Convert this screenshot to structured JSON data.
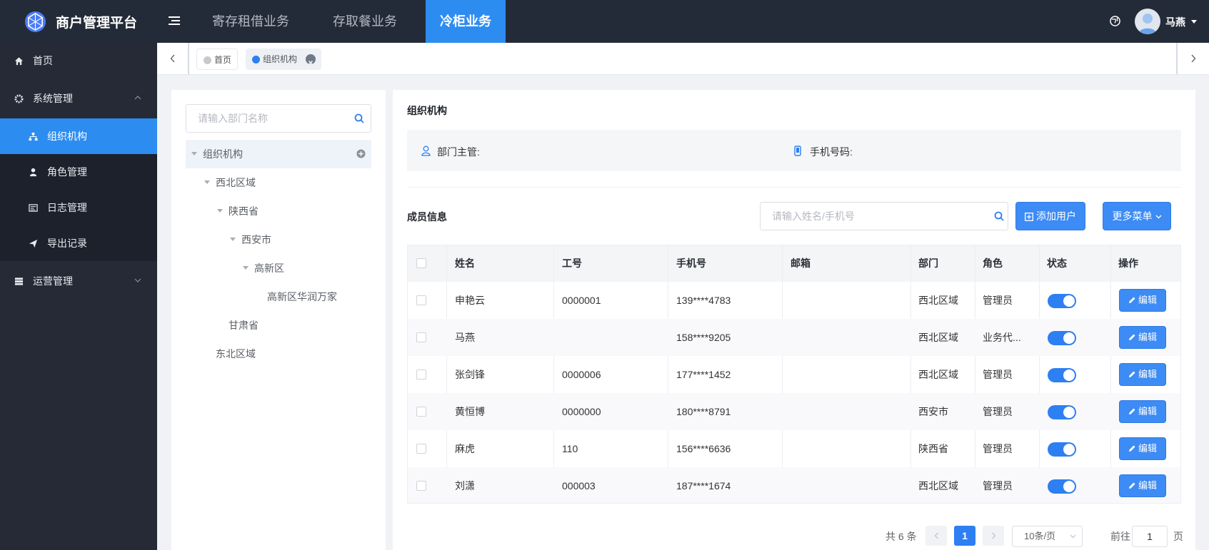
{
  "header": {
    "brand": "商户管理平台",
    "nav": [
      "寄存租借业务",
      "存取餐业务",
      "冷柜业务"
    ],
    "active_nav": "冷柜业务",
    "username": "马燕",
    "logo_icon": "hexagon-logo-icon",
    "colors": {
      "topbar": "#242b38",
      "accent": "#2d8cf0"
    }
  },
  "sidebar": {
    "items": [
      {
        "label": "首页",
        "icon": "home-icon"
      },
      {
        "label": "系统管理",
        "icon": "gear-icon",
        "expanded": true
      },
      {
        "label": "组织机构",
        "icon": "org-chart-icon",
        "active": true
      },
      {
        "label": "角色管理",
        "icon": "user-icon"
      },
      {
        "label": "日志管理",
        "icon": "log-icon"
      },
      {
        "label": "导出记录",
        "icon": "paper-plane-icon"
      },
      {
        "label": "运营管理",
        "icon": "server-icon",
        "expanded": false
      }
    ]
  },
  "tabs": [
    {
      "label": "首页"
    },
    {
      "label": "组织机构",
      "active": true
    }
  ],
  "tree": {
    "search_placeholder": "请输入部门名称",
    "nodes": [
      "组织机构",
      "西北区域",
      "陕西省",
      "西安市",
      "高新区",
      "高新区华润万家",
      "甘肃省",
      "东北区域"
    ]
  },
  "org": {
    "title": "组织机构",
    "manager_label": "部门主管:",
    "phone_label": "手机号码:"
  },
  "members": {
    "title": "成员信息",
    "search_placeholder": "请输入姓名/手机号",
    "add_button": "添加用户",
    "more_button": "更多菜单",
    "columns": [
      "姓名",
      "工号",
      "手机号",
      "邮箱",
      "部门",
      "角色",
      "状态",
      "操作"
    ],
    "edit_label": "编辑",
    "rows": [
      {
        "name": "申艳云",
        "id": "0000001",
        "phone": "139****4783",
        "email": "",
        "dept": "西北区域",
        "role": "管理员",
        "enabled": true
      },
      {
        "name": "马燕",
        "id": "",
        "phone": "158****9205",
        "email": "",
        "dept": "西北区域",
        "role": "业务代...",
        "enabled": true
      },
      {
        "name": "张剑锋",
        "id": "0000006",
        "phone": "177****1452",
        "email": "",
        "dept": "西北区域",
        "role": "管理员",
        "enabled": true
      },
      {
        "name": "黄恒博",
        "id": "0000000",
        "phone": "180****8791",
        "email": "",
        "dept": "西安市",
        "role": "管理员",
        "enabled": true
      },
      {
        "name": "麻虎",
        "id": "110",
        "phone": "156****6636",
        "email": "",
        "dept": "陕西省",
        "role": "管理员",
        "enabled": true
      },
      {
        "name": "刘潇",
        "id": "000003",
        "phone": "187****1674",
        "email": "",
        "dept": "西北区域",
        "role": "管理员",
        "enabled": true
      }
    ]
  },
  "pagination": {
    "total": "共 6 条",
    "current_page": "1",
    "page_size": "10条/页",
    "goto_label": "前往",
    "goto_value": "1",
    "page_suffix": "页"
  }
}
